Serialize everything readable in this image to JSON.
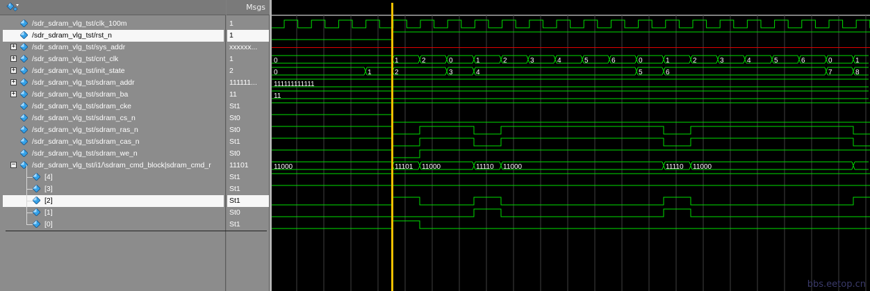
{
  "msgs_header": "Msgs",
  "watermark": "bbs.eetop.cn",
  "signals": [
    {
      "name": "/sdr_sdram_vlg_tst/clk_100m",
      "value": "1",
      "expandable": false,
      "selected": false,
      "child": false
    },
    {
      "name": "/sdr_sdram_vlg_tst/rst_n",
      "value": "1",
      "expandable": false,
      "selected": true,
      "child": false
    },
    {
      "name": "/sdr_sdram_vlg_tst/sys_addr",
      "value": "xxxxxx...",
      "expandable": true,
      "selected": false,
      "child": false
    },
    {
      "name": "/sdr_sdram_vlg_tst/cnt_clk",
      "value": "1",
      "expandable": true,
      "selected": false,
      "child": false
    },
    {
      "name": "/sdr_sdram_vlg_tst/init_state",
      "value": "2",
      "expandable": true,
      "selected": false,
      "child": false
    },
    {
      "name": "/sdr_sdram_vlg_tst/sdram_addr",
      "value": "111111...",
      "expandable": true,
      "selected": false,
      "child": false
    },
    {
      "name": "/sdr_sdram_vlg_tst/sdram_ba",
      "value": "11",
      "expandable": true,
      "selected": false,
      "child": false
    },
    {
      "name": "/sdr_sdram_vlg_tst/sdram_cke",
      "value": "St1",
      "expandable": false,
      "selected": false,
      "child": false
    },
    {
      "name": "/sdr_sdram_vlg_tst/sdram_cs_n",
      "value": "St0",
      "expandable": false,
      "selected": false,
      "child": false
    },
    {
      "name": "/sdr_sdram_vlg_tst/sdram_ras_n",
      "value": "St0",
      "expandable": false,
      "selected": false,
      "child": false
    },
    {
      "name": "/sdr_sdram_vlg_tst/sdram_cas_n",
      "value": "St1",
      "expandable": false,
      "selected": false,
      "child": false
    },
    {
      "name": "/sdr_sdram_vlg_tst/sdram_we_n",
      "value": "St0",
      "expandable": false,
      "selected": false,
      "child": false
    },
    {
      "name": "/sdr_sdram_vlg_tst/i1/\\sdram_cmd_block|sdram_cmd_r",
      "value": "11101",
      "expandable": true,
      "expanded": true,
      "selected": false,
      "child": false
    },
    {
      "name": "[4]",
      "value": "St1",
      "expandable": false,
      "selected": false,
      "child": true
    },
    {
      "name": "[3]",
      "value": "St1",
      "expandable": false,
      "selected": false,
      "child": true
    },
    {
      "name": "[2]",
      "value": "St1",
      "expandable": false,
      "selected": true,
      "child": true
    },
    {
      "name": "[1]",
      "value": "St0",
      "expandable": false,
      "selected": false,
      "child": true
    },
    {
      "name": "[0]",
      "value": "St1",
      "expandable": false,
      "selected": false,
      "child": true
    }
  ],
  "bus_labels": {
    "cnt_clk": [
      "0",
      "1",
      "2",
      "0",
      "1",
      "2",
      "3",
      "4",
      "5",
      "6",
      "0",
      "1",
      "2",
      "3",
      "4",
      "5",
      "6",
      "0",
      "1"
    ],
    "init_state": [
      "0",
      "1",
      "2",
      "3",
      "4",
      "5",
      "6",
      "7",
      "8"
    ],
    "sdram_addr": "111111111111",
    "sdram_ba": "11",
    "sdram_cmd_r": [
      "11000",
      "11101",
      "11000",
      "11110",
      "11000",
      "11110",
      "11000"
    ]
  },
  "colors": {
    "wave": "#00e000",
    "bus_text": "#ffffff",
    "unknown": "#e00000",
    "cursor": "#f0c000",
    "grid": "#404040"
  }
}
